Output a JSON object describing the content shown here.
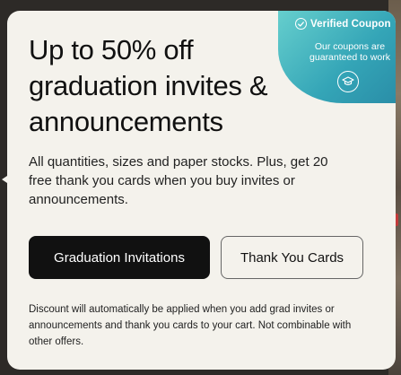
{
  "coupon": {
    "title": "Verified Coupon",
    "subtitle": "Our coupons are guaranteed to work",
    "icon": "graduation-cap-icon",
    "verified_icon": "check-circle-icon"
  },
  "promo": {
    "headline": "Up to 50% off graduation invites & announcements",
    "description": "All quantities, sizes and paper stocks. Plus, get 20 free thank you cards when you buy invites or announcements.",
    "disclaimer": "Discount will automatically be applied when you add grad invites or announcements and thank you cards to your cart. Not combinable with other offers."
  },
  "buttons": {
    "primary_label": "Graduation Invitations",
    "secondary_label": "Thank You Cards"
  },
  "colors": {
    "card_bg": "#f4f2ec",
    "primary_button": "#111111",
    "coupon_teal": "#34a5b7"
  }
}
